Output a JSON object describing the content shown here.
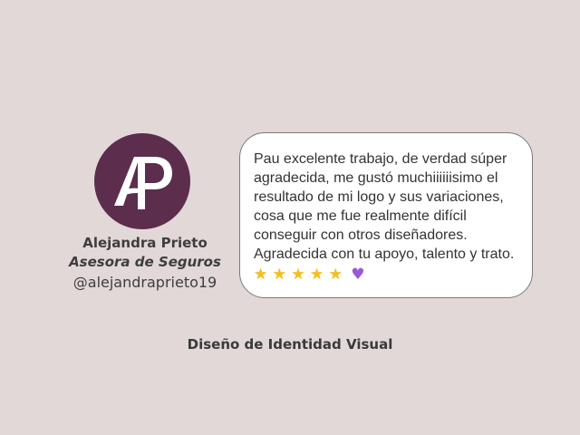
{
  "profile": {
    "name": "Alejandra Prieto",
    "role": "Asesora de Seguros",
    "handle": "@alejandraprieto19",
    "logo_bg": "#5c2d4d",
    "logo_icon": "ap-monogram-logo"
  },
  "review": {
    "text": "Pau excelente trabajo, de verdad súper agradecida, me gustó muchiiiiiisimo el resultado de mi logo y sus variaciones, cosa que me fue realmente difícil conseguir con otros diseñadores. Agradecida con tu apoyo, talento y trato.",
    "rating": 5,
    "star_glyph": "★",
    "heart_glyph": "♥",
    "star_color": "#f3c01f",
    "heart_color": "#9a5ad8"
  },
  "service": "Diseño de Identidad Visual"
}
